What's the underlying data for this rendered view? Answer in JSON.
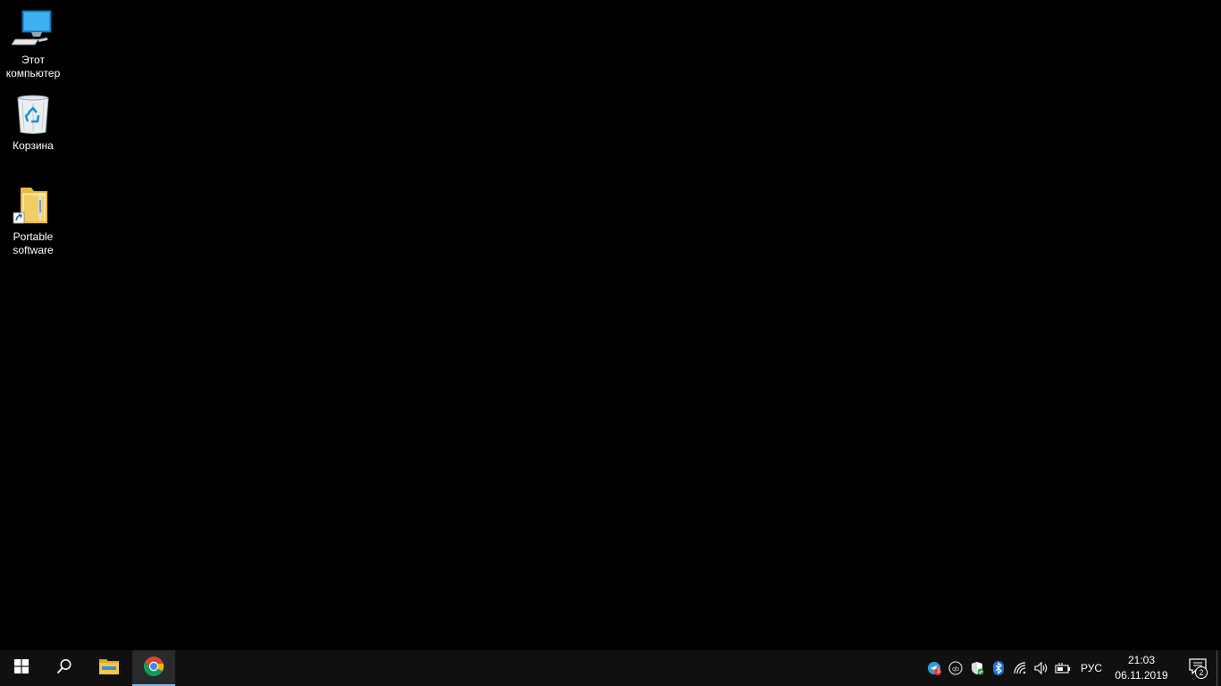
{
  "desktop": {
    "background_color": "#000000",
    "icons": [
      {
        "id": "this-pc",
        "label": "Этот компьютер",
        "icon": "computer-icon"
      },
      {
        "id": "recycle",
        "label": "Корзина",
        "icon": "recycle-bin-icon"
      },
      {
        "id": "portable",
        "label": "Portable software",
        "icon": "folder-shortcut-icon"
      }
    ]
  },
  "taskbar": {
    "background_color": "#101010",
    "accent_color": "#76b9ed",
    "start_icon": "windows-logo-icon",
    "search_icon": "search-icon",
    "pinned_apps": [
      {
        "name": "File Explorer",
        "icon": "file-explorer-icon",
        "active": false
      },
      {
        "name": "Google Chrome",
        "icon": "chrome-icon",
        "active": true
      }
    ],
    "tray": {
      "icons": [
        "telegram-icon",
        "qbittorrent-icon",
        "windows-security-icon",
        "bluetooth-icon",
        "wifi-icon",
        "volume-icon",
        "battery-icon"
      ],
      "telegram_badge": "1",
      "language": "РУС",
      "time": "21:03",
      "date": "06.11.2019",
      "notification_count": "2"
    }
  }
}
